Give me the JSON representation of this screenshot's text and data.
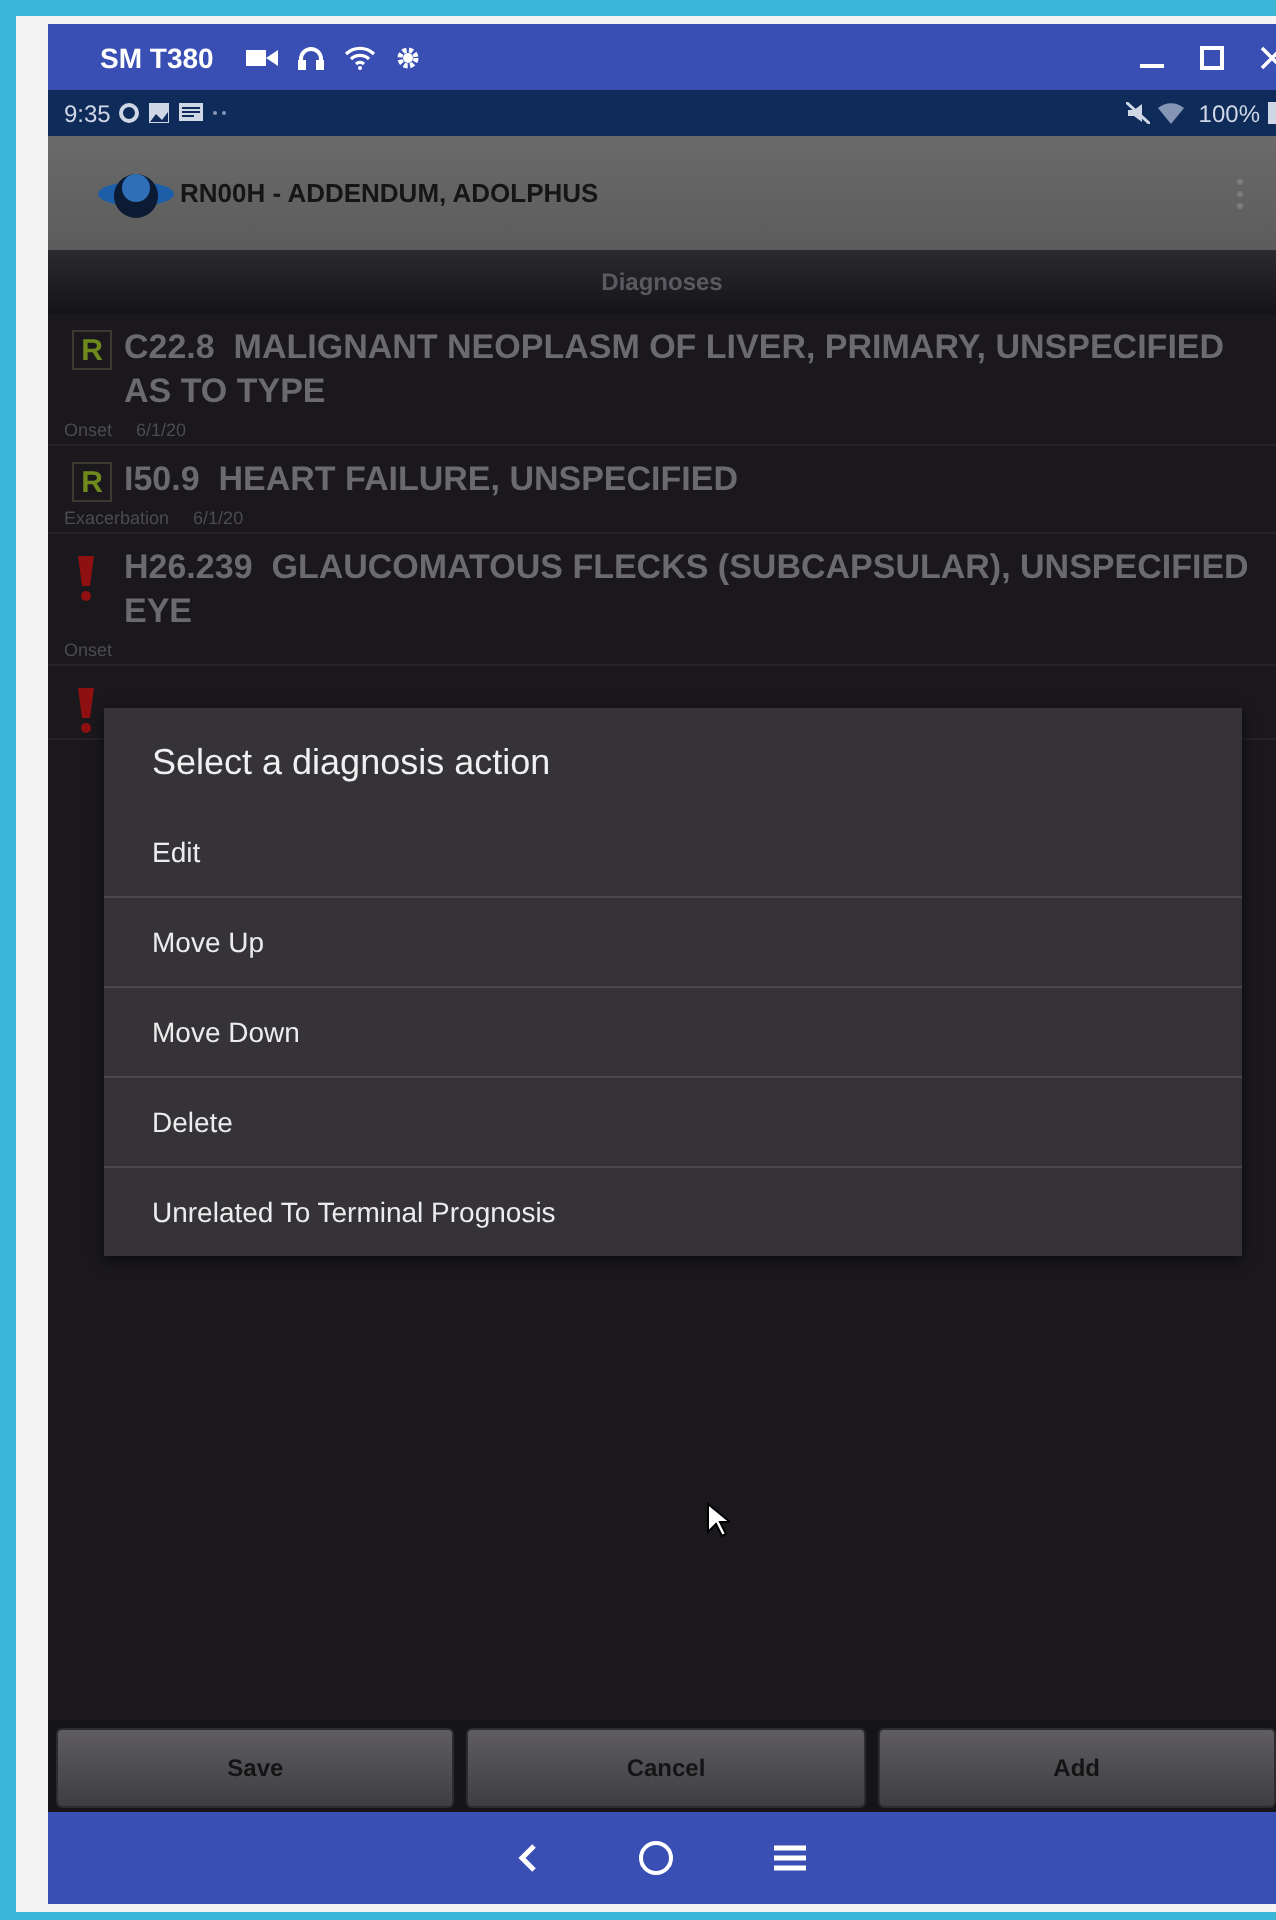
{
  "window": {
    "title": "SM T380"
  },
  "status_bar": {
    "time": "9:35",
    "battery": "100%"
  },
  "header": {
    "title": "RN00H - ADDENDUM, ADOLPHUS"
  },
  "section": {
    "title": "Diagnoses"
  },
  "diagnoses": [
    {
      "kind": "related",
      "code": "C22.8",
      "name": "MALIGNANT NEOPLASM OF LIVER, PRIMARY, UNSPECIFIED AS TO TYPE",
      "badge": "R",
      "meta_label": "Onset",
      "meta_date": "6/1/20"
    },
    {
      "kind": "related",
      "code": "I50.9",
      "name": "HEART FAILURE, UNSPECIFIED",
      "badge": "R",
      "meta_label": "Exacerbation",
      "meta_date": "6/1/20"
    },
    {
      "kind": "alert",
      "code": "H26.239",
      "name": "GLAUCOMATOUS FLECKS (SUBCAPSULAR), UNSPECIFIED EYE",
      "meta_label": "Onset"
    },
    {
      "kind": "alert"
    }
  ],
  "dialog": {
    "title": "Select a diagnosis action",
    "options": [
      "Edit",
      "Move Up",
      "Move Down",
      "Delete",
      "Unrelated To Terminal Prognosis"
    ]
  },
  "buttons": [
    "Save",
    "Cancel",
    "Add"
  ]
}
